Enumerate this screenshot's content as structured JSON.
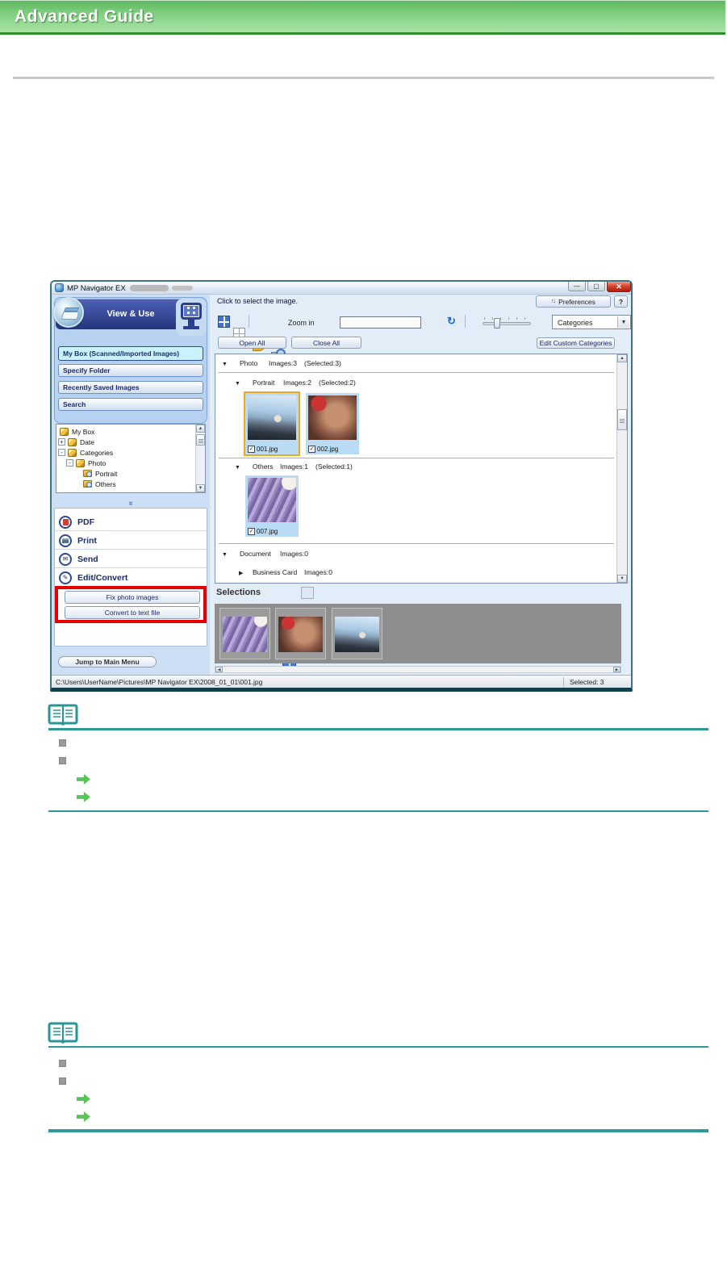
{
  "page": {
    "header_title": "Advanced Guide"
  },
  "window": {
    "title": "MP Navigator EX",
    "sidebar": {
      "mode_label": "View & Use",
      "nav_buttons": [
        {
          "label": "My Box (Scanned/Imported Images)",
          "selected": true
        },
        {
          "label": "Specify Folder",
          "selected": false
        },
        {
          "label": "Recently Saved Images",
          "selected": false
        },
        {
          "label": "Search",
          "selected": false
        }
      ],
      "tree": [
        {
          "label": "My Box",
          "expander": ""
        },
        {
          "label": "Date",
          "expander": "+"
        },
        {
          "label": "Categories",
          "expander": "-"
        },
        {
          "label": "Photo",
          "expander": "-"
        },
        {
          "label": "Portrait",
          "expander": ""
        },
        {
          "label": "Others",
          "expander": ""
        }
      ],
      "tasks": [
        {
          "label": "PDF"
        },
        {
          "label": "Print"
        },
        {
          "label": "Send"
        },
        {
          "label": "Edit/Convert"
        }
      ],
      "highlighted_buttons": [
        {
          "label": "Fix photo images"
        },
        {
          "label": "Convert to text file"
        }
      ],
      "jump_button_label": "Jump to Main Menu"
    },
    "content": {
      "hint": "Click to select the image.",
      "preferences_label": "Preferences",
      "help_label": "?",
      "toolbar": {
        "zoom_in_label": "Zoom in",
        "search_value": "",
        "categories_value": "Categories"
      },
      "buttons": {
        "open_all": "Open All",
        "close_all": "Close All",
        "edit_custom_categories": "Edit Custom Categories"
      },
      "groups": [
        {
          "name": "Photo",
          "images": "Images:3",
          "selected": "(Selected:3)"
        },
        {
          "name": "Portrait",
          "images": "Images:2",
          "selected": "(Selected:2)"
        },
        {
          "name": "Others",
          "images": "Images:1",
          "selected": "(Selected:1)"
        },
        {
          "name": "Document",
          "images": "Images:0",
          "selected": ""
        },
        {
          "name": "Business Card",
          "images": "Images:0",
          "selected": ""
        }
      ],
      "thumbnails": [
        {
          "filename": "001.jpg",
          "checked": true,
          "highlighted": true
        },
        {
          "filename": "002.jpg",
          "checked": true,
          "highlighted": false
        },
        {
          "filename": "007.jpg",
          "checked": true,
          "highlighted": false
        }
      ],
      "selections_label": "Selections",
      "status": {
        "path": "C:\\Users\\UserName\\Pictures\\MP Navigator EX\\2008_01_01\\001.jpg",
        "selected_count": "Selected: 3"
      }
    }
  },
  "colors": {
    "header_green": "#6cc06c",
    "note_rule_teal": "#2e9798",
    "link_arrow_green": "#55c655",
    "highlight_red": "#e60000",
    "selection_orange": "#f2a71f"
  }
}
